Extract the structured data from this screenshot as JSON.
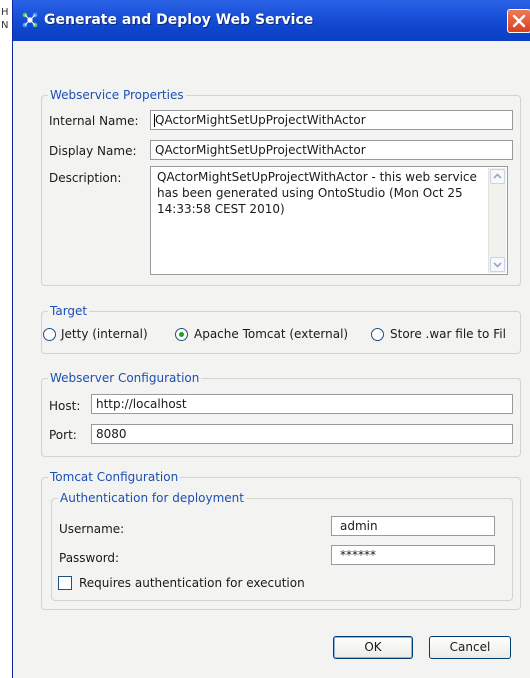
{
  "background": {
    "fragment_1": "H",
    "fragment_2": "N"
  },
  "window": {
    "title": "Generate and Deploy Web Service",
    "icon": "app-network-icon",
    "close_icon": "close-icon"
  },
  "webservice_properties": {
    "legend": "Webservice Properties",
    "internal_name_label": "Internal Name:",
    "internal_name_value": "QActorMightSetUpProjectWithActor",
    "display_name_label": "Display Name:",
    "display_name_value": "QActorMightSetUpProjectWithActor",
    "description_label": "Description:",
    "description_value": "QActorMightSetUpProjectWithActor - this web service has been generated using OntoStudio (Mon Oct 25 14:33:58 CEST 2010)"
  },
  "target": {
    "legend": "Target",
    "options": [
      {
        "label": "Jetty (internal)",
        "selected": false
      },
      {
        "label": "Apache Tomcat (external)",
        "selected": true
      },
      {
        "label": "Store .war file to Fil",
        "selected": false
      }
    ]
  },
  "webserver_configuration": {
    "legend": "Webserver Configuration",
    "host_label": "Host:",
    "host_value": "http://localhost",
    "port_label": "Port:",
    "port_value": "8080"
  },
  "tomcat_configuration": {
    "legend": "Tomcat Configuration",
    "auth": {
      "legend": "Authentication for deployment",
      "username_label": "Username:",
      "username_value": "admin",
      "password_label": "Password:",
      "password_value": "******",
      "requires_auth_label": "Requires authentication for execution",
      "requires_auth_checked": false
    }
  },
  "buttons": {
    "ok": "OK",
    "cancel": "Cancel"
  },
  "colors": {
    "titlebar": "#0f44cc",
    "legend_text": "#1c4fb5",
    "dialog_bg": "#f3f3f1",
    "radio_dot": "#22a01f",
    "close_button": "#d8401f"
  }
}
